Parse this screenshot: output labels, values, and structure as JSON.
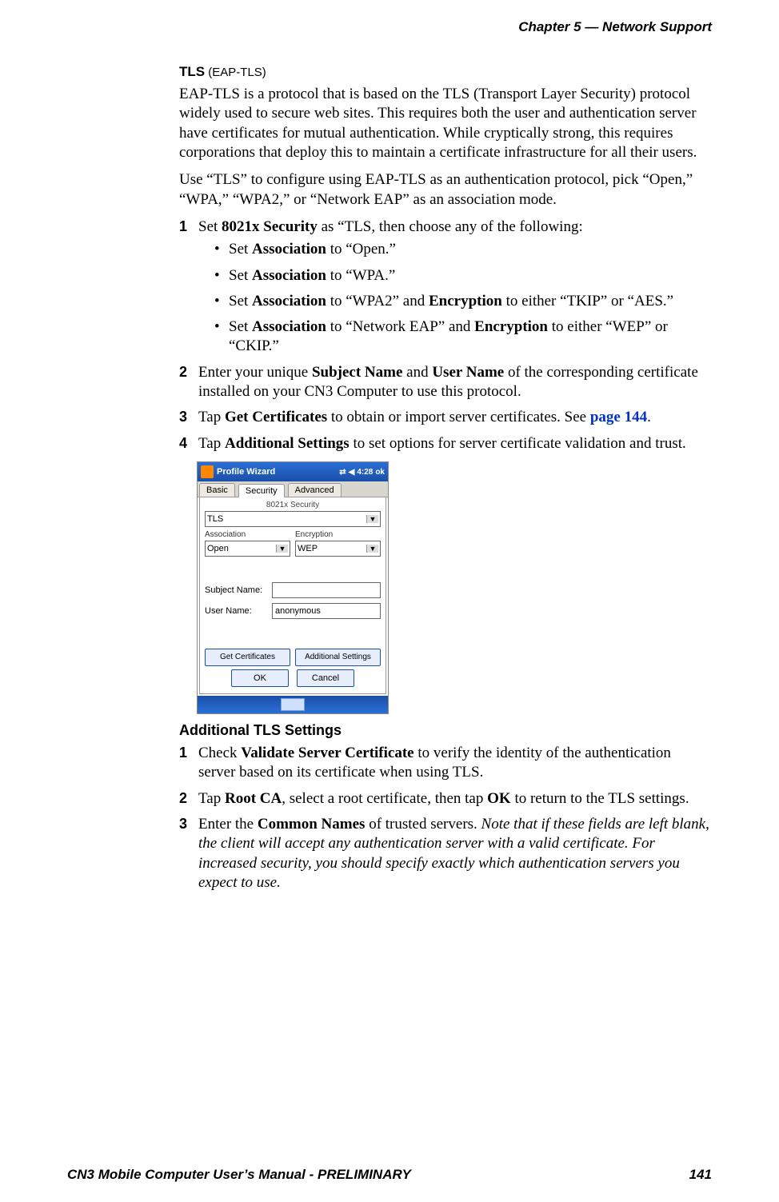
{
  "header": {
    "chapter": "Chapter 5 —  Network Support"
  },
  "section": {
    "title_bold": "TLS",
    "title_paren": " (EAP-TLS)",
    "para1": "EAP-TLS is a protocol that is based on the TLS (Transport Layer Security) protocol widely used to secure web sites. This requires both the user and authentication server have certificates for mutual authentication. While cryptically strong, this requires corporations that deploy this to maintain a certificate infrastructure for all their users.",
    "para2": "Use “TLS” to configure using EAP-TLS as an authentication protocol, pick “Open,” “WPA,” “WPA2,” or “Network EAP” as an association mode.",
    "steps": {
      "s1_pre": "Set ",
      "s1_bold1": "8021x Security",
      "s1_post": " as “TLS, then choose any of the following:",
      "bullets": {
        "b1_pre": "Set ",
        "b1_bold": "Association",
        "b1_post": " to “Open.”",
        "b2_pre": "Set ",
        "b2_bold": "Association",
        "b2_post": " to “WPA.”",
        "b3_pre": "Set ",
        "b3_bold1": "Association",
        "b3_mid": " to “WPA2” and ",
        "b3_bold2": "Encryption",
        "b3_post": " to either “TKIP” or “AES.”",
        "b4_pre": "Set ",
        "b4_bold1": "Association",
        "b4_mid": " to “Network EAP” and ",
        "b4_bold2": "Encryption",
        "b4_post": " to either “WEP” or “CKIP.”"
      },
      "s2_pre": "Enter your unique ",
      "s2_bold1": "Subject Name",
      "s2_mid": " and ",
      "s2_bold2": "User Name",
      "s2_post": " of the corresponding certificate installed on your CN3 Computer to use this protocol.",
      "s3_pre": "Tap ",
      "s3_bold": "Get Certificates",
      "s3_mid": " to obtain or import server certificates. See ",
      "s3_link": "page 144",
      "s3_post": ".",
      "s4_pre": "Tap ",
      "s4_bold": "Additional Settings",
      "s4_post": " to set options for server certificate validation and trust."
    },
    "sub_heading": "Additional TLS Settings",
    "steps2": {
      "a1_pre": "Check ",
      "a1_bold": "Validate Server Certificate",
      "a1_post": " to verify the identity of the authenti­cation server based on its certificate when using TLS.",
      "a2_pre": "Tap ",
      "a2_bold1": "Root CA",
      "a2_mid": ", select a root certificate, then tap ",
      "a2_bold2": "OK",
      "a2_post": " to return to the TLS settings.",
      "a3_pre": "Enter the ",
      "a3_bold": "Common Names",
      "a3_mid": " of trusted servers. ",
      "a3_ital": "Note that if these fields are left blank, the client will accept any authentication server with a valid certif­icate. For increased security, you should specify exactly which authentication servers you expect to use."
    }
  },
  "device": {
    "window_title": "Profile Wizard",
    "time": "4:28",
    "ok": "ok",
    "tabs": {
      "basic": "Basic",
      "security": "Security",
      "advanced": "Advanced"
    },
    "group_label": "8021x Security",
    "security_value": "TLS",
    "assoc_label": "Association",
    "assoc_value": "Open",
    "enc_label": "Encryption",
    "enc_value": "WEP",
    "subject_label": "Subject Name:",
    "subject_value": "",
    "user_label": "User Name:",
    "user_value": "anonymous",
    "btn_getcerts": "Get Certificates",
    "btn_addl": "Additional Settings",
    "btn_ok": "OK",
    "btn_cancel": "Cancel"
  },
  "footer": {
    "left": "CN3 Mobile Computer User’s Manual - PRELIMINARY",
    "right": "141"
  }
}
